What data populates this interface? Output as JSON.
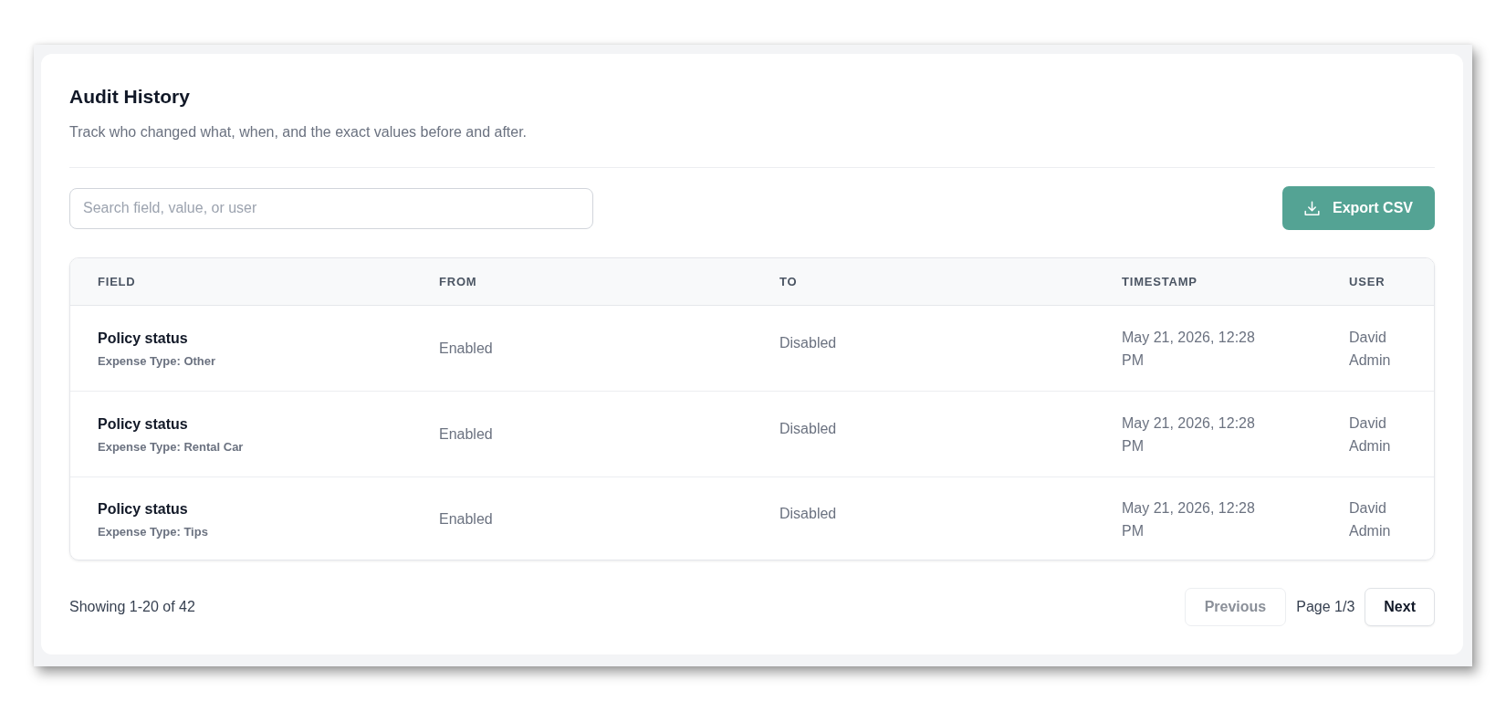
{
  "header": {
    "title": "Audit History",
    "subtitle": "Track who changed what, when, and the exact values before and after."
  },
  "search": {
    "placeholder": "Search field, value, or user"
  },
  "export_button": {
    "label": "Export CSV"
  },
  "table": {
    "columns": [
      "FIELD",
      "FROM",
      "TO",
      "TIMESTAMP",
      "USER"
    ],
    "rows": [
      {
        "field": "Policy status",
        "detail": "Expense Type: Other",
        "from": "Enabled",
        "to": "Disabled",
        "timestamp": "May 21, 2026, 12:28 PM",
        "user": "David Admin"
      },
      {
        "field": "Policy status",
        "detail": "Expense Type: Rental Car",
        "from": "Enabled",
        "to": "Disabled",
        "timestamp": "May 21, 2026, 12:28 PM",
        "user": "David Admin"
      },
      {
        "field": "Policy status",
        "detail": "Expense Type: Tips",
        "from": "Enabled",
        "to": "Disabled",
        "timestamp": "May 21, 2026, 12:28 PM",
        "user": "David Admin"
      }
    ]
  },
  "footer": {
    "summary": "Showing 1-20 of 42",
    "page": "Page 1/3",
    "buttons": [
      {
        "label": "Previous",
        "disabled": true
      },
      {
        "label": "Next",
        "disabled": false
      }
    ]
  }
}
